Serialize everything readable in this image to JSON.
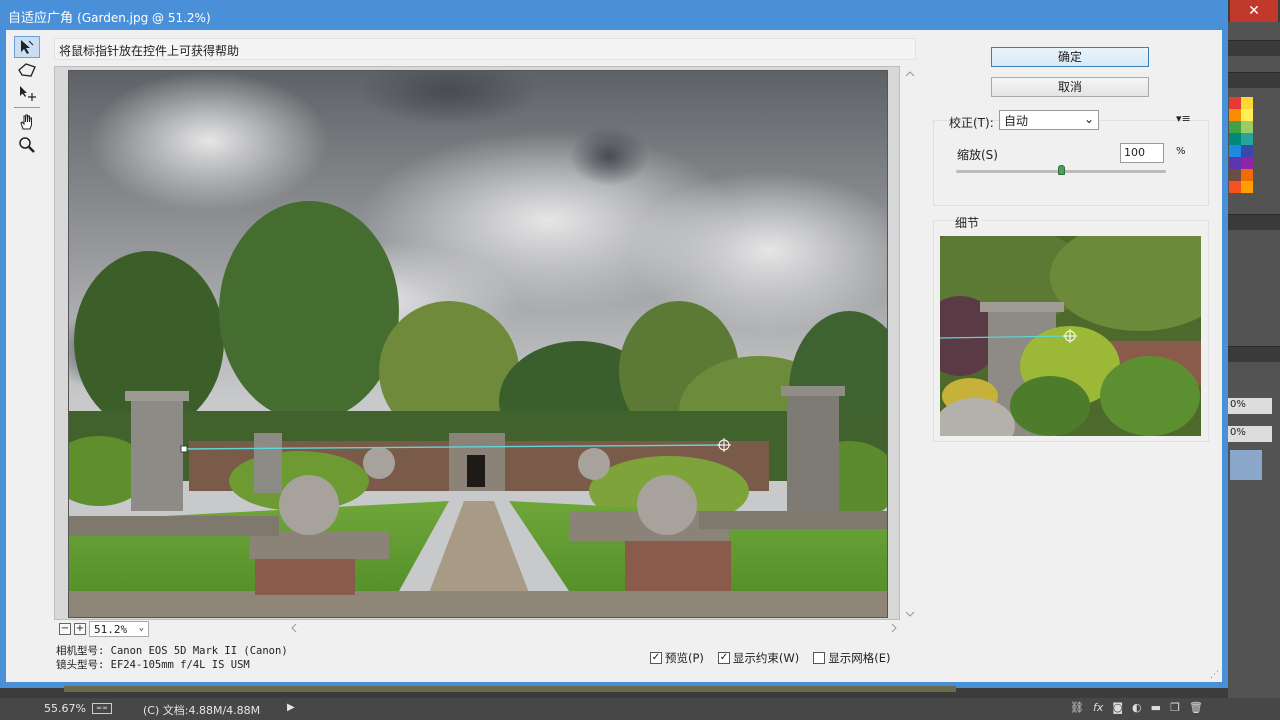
{
  "window": {
    "title": "自适应广角",
    "file_info": "(Garden.jpg @ 51.2%)",
    "close_symbol": "✕"
  },
  "hint": "将鼠标指针放在控件上可获得帮助",
  "tools": [
    {
      "name": "constraint-tool",
      "icon": "arrow-pointer-icon"
    },
    {
      "name": "polygon-constraint-tool",
      "icon": "polygon-icon"
    },
    {
      "name": "move-tool",
      "icon": "move-icon"
    },
    {
      "name": "hand-tool",
      "icon": "hand-icon"
    },
    {
      "name": "zoom-tool",
      "icon": "magnifier-icon"
    }
  ],
  "zoom": {
    "minus": "−",
    "plus": "+",
    "value": "51.2%"
  },
  "camera": {
    "model": "相机型号: Canon EOS 5D Mark II (Canon)",
    "lens": "镜头型号: EF24-105mm f/4L IS USM"
  },
  "checkboxes": [
    {
      "label": "预览(P)",
      "checked": true
    },
    {
      "label": "显示约束(W)",
      "checked": true
    },
    {
      "label": "显示网格(E)",
      "checked": false
    }
  ],
  "buttons": {
    "ok": "确定",
    "cancel": "取消"
  },
  "correction": {
    "label": "校正(T):",
    "value": "自动",
    "scale_label": "缩放(S)",
    "scale_value": "100",
    "scale_unit": "%",
    "scale_slider_fraction": 0.5
  },
  "detail": {
    "label": "细节"
  },
  "photoshop": {
    "status_zoom": "55.67%",
    "status_doc": "(C) 文档:4.88M/4.88M",
    "pct_1": "0%",
    "pct_2": "0%",
    "swatch_colors": [
      "#e53935",
      "#fdd835",
      "#fb8c00",
      "#ffee58",
      "#43a047",
      "#9ccc65",
      "#00897b",
      "#26a69a",
      "#1e88e5",
      "#3949ab",
      "#5e35b1",
      "#8e24aa",
      "#6d4c41",
      "#ef6c00",
      "#f4511e",
      "#ffa000"
    ]
  }
}
